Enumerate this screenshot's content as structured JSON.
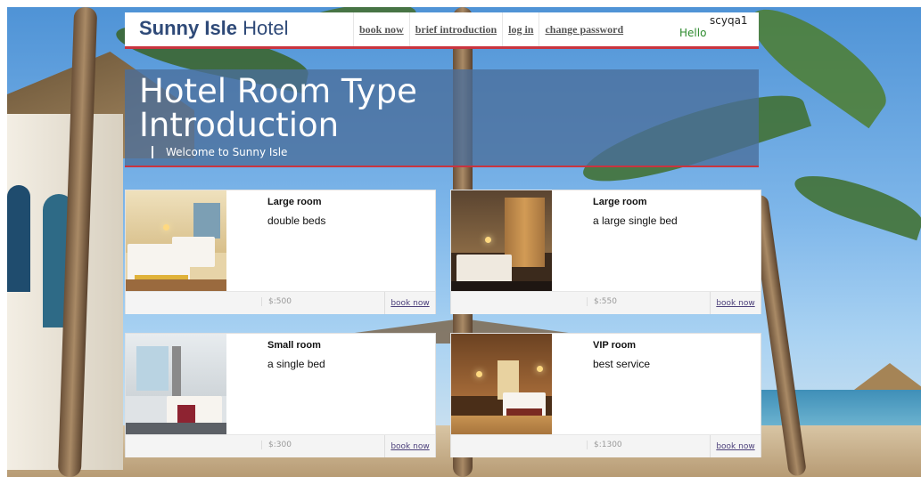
{
  "header": {
    "brand_bold": "Sunny Isle",
    "brand_light": " Hotel",
    "nav": [
      "book now",
      "brief introduction",
      "log in",
      "change password"
    ],
    "hello": "Hello",
    "username": "scyqa1"
  },
  "hero": {
    "title": "Hotel Room Type Introduction",
    "subtitle": "Welcome to Sunny Isle"
  },
  "rooms": [
    {
      "name": "Large room",
      "desc": "double beds",
      "price": "$:500",
      "book": "book now"
    },
    {
      "name": "Large room",
      "desc": "a large single bed",
      "price": "$:550",
      "book": "book now"
    },
    {
      "name": "Small room",
      "desc": "a single bed",
      "price": "$:300",
      "book": "book now"
    },
    {
      "name": "VIP room",
      "desc": "best service",
      "price": "$:1300",
      "book": "book now"
    }
  ],
  "colors": {
    "accent_red": "#c9343f",
    "brand_blue": "#2f4a78",
    "hero_blue": "#4a6e9b",
    "hello_green": "#2e8b2e"
  }
}
